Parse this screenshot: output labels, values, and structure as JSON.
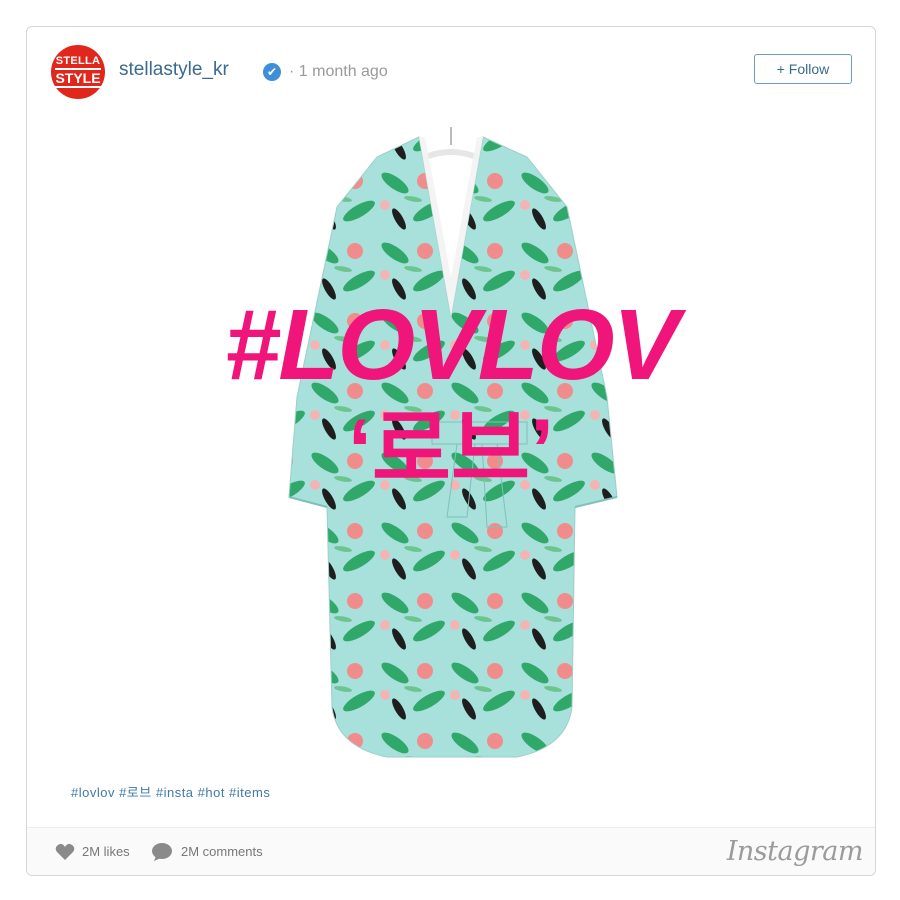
{
  "post": {
    "username": "stellastyle_kr",
    "time": "· 1 month ago",
    "follow_label": "+ Follow",
    "avatar": {
      "line1": "STELLA",
      "line2": "STYLE",
      "color": "#e1261c"
    },
    "verified_icon": "✔"
  },
  "overlay": {
    "line1": "#LOVLOV",
    "line2": "‘로브’",
    "color": "#f0157a"
  },
  "caption": {
    "hashtags": "#lovlov #로브 #insta #hot #items"
  },
  "footer": {
    "likes": "2M likes",
    "comments": "2M comments",
    "brand": "Instagram"
  },
  "colors": {
    "robe_base": "#a8e0dc",
    "leaf_green": "#2fa86a",
    "leaf_dark": "#1e1e1e",
    "blossom": "#f08c8c"
  }
}
